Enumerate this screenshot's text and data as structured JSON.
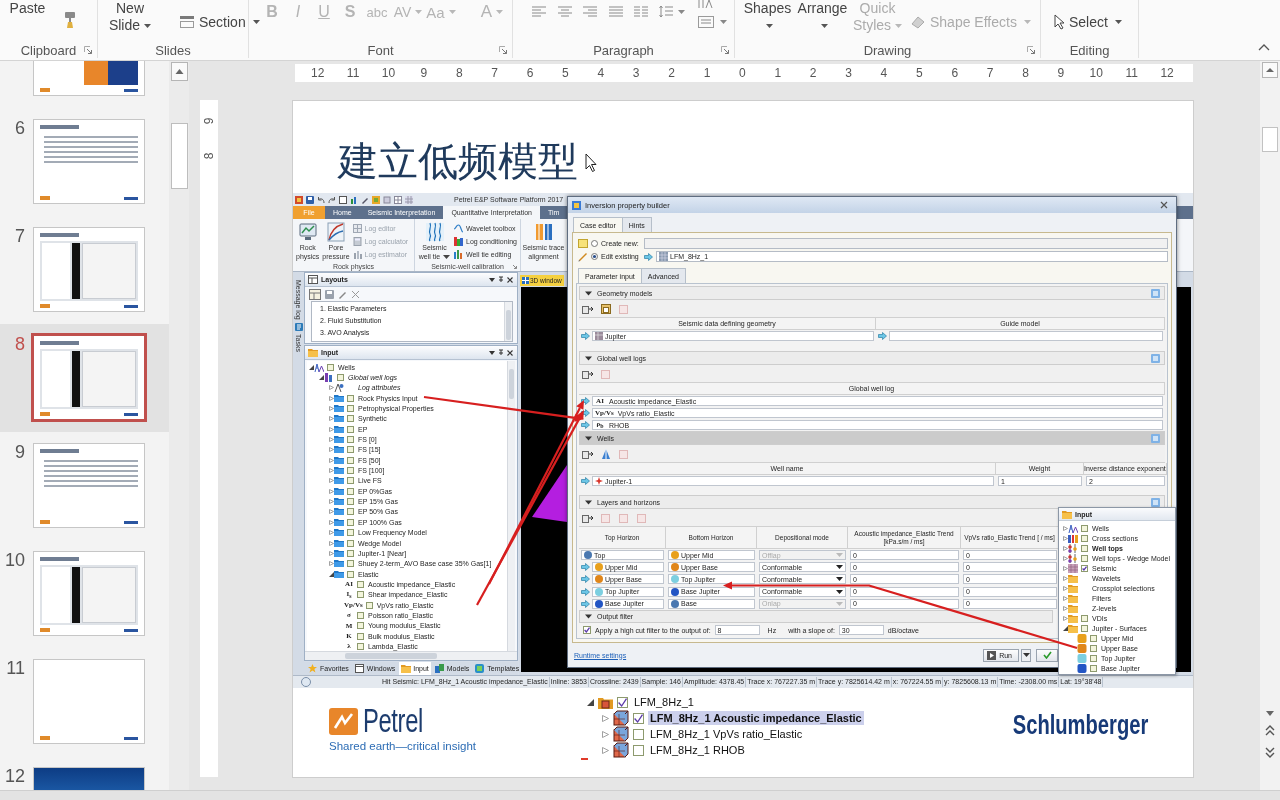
{
  "ribbon": {
    "groups": [
      {
        "label": "Clipboard",
        "launcher": true,
        "buttons": [
          {
            "kind": "large",
            "label": "Paste",
            "disabled": false
          }
        ]
      },
      {
        "label": "Slides",
        "buttons": [
          {
            "kind": "large",
            "label": "New Slide",
            "dropdown": true,
            "disabled": false
          },
          {
            "kind": "small",
            "label": "Section",
            "dropdown": true,
            "disabled": false
          }
        ]
      },
      {
        "label": "Font",
        "launcher": true,
        "buttons": [
          {
            "kind": "glyph",
            "label": "B",
            "disabled": true
          },
          {
            "kind": "glyph",
            "label": "I",
            "disabled": true
          },
          {
            "kind": "glyph",
            "label": "U",
            "disabled": true
          },
          {
            "kind": "glyph",
            "label": "S",
            "disabled": true
          },
          {
            "kind": "glyph",
            "label": "abc",
            "disabled": true
          },
          {
            "kind": "glyph",
            "label": "AV",
            "dropdown": true,
            "disabled": true
          },
          {
            "kind": "glyph",
            "label": "Aa",
            "dropdown": true,
            "disabled": true
          },
          {
            "kind": "glyph",
            "label": "A",
            "dropdown": true,
            "disabled": true
          }
        ]
      },
      {
        "label": "Paragraph",
        "launcher": true
      },
      {
        "label": "Drawing",
        "launcher": true,
        "buttons": [
          {
            "kind": "large",
            "label": "Shapes",
            "dropdown": true,
            "disabled": false
          },
          {
            "kind": "large",
            "label": "Arrange",
            "dropdown": true,
            "disabled": false
          },
          {
            "kind": "large",
            "label": "Quick Styles",
            "dropdown": true,
            "disabled": true
          },
          {
            "kind": "small",
            "label": "Shape Effects",
            "dropdown": true,
            "disabled": true
          }
        ]
      },
      {
        "label": "Editing",
        "buttons": [
          {
            "kind": "small",
            "label": "Select",
            "dropdown": true,
            "disabled": false
          }
        ]
      }
    ]
  },
  "slides_panel": {
    "slides": [
      {
        "kind": "picture",
        "selected": false
      },
      {
        "number": "6",
        "kind": "text",
        "selected": false
      },
      {
        "number": "7",
        "kind": "screenshot",
        "selected": false
      },
      {
        "number": "8",
        "kind": "screenshot",
        "selected": true
      },
      {
        "number": "9",
        "kind": "text",
        "selected": false
      },
      {
        "number": "10",
        "kind": "screenshot",
        "selected": false
      },
      {
        "number": "11",
        "kind": "blank",
        "selected": false
      },
      {
        "number": "12",
        "kind": "cover",
        "selected": false
      }
    ]
  },
  "rulers": {
    "horizontal": [
      "12",
      "11",
      "10",
      "9",
      "8",
      "7",
      "6",
      "5",
      "4",
      "3",
      "2",
      "1",
      "0",
      "1",
      "2",
      "3",
      "4",
      "5",
      "6",
      "7",
      "8",
      "9",
      "10",
      "11",
      "12"
    ],
    "vertical": [
      "9",
      "8"
    ]
  },
  "slide": {
    "title": "建立低频模型",
    "screenshot": {
      "title": "Petrel E&P Software Platform 2017",
      "tabs": [
        {
          "kind": "file",
          "label": "File",
          "selected": false
        },
        {
          "kind": "tab",
          "label": "Home",
          "selected": false
        },
        {
          "kind": "tab",
          "label": "Seismic Interpretation",
          "selected": false
        },
        {
          "kind": "tab",
          "label": "Quantitative Interpretation",
          "selected": true
        },
        {
          "kind": "tab",
          "label": "Tim",
          "selected": false
        }
      ],
      "ribbon": [
        {
          "label": "Rock physics",
          "buttons": [
            {
              "kind": "large",
              "label": "Rock physics",
              "disabled": false
            },
            {
              "kind": "large",
              "label": "Pore pressure",
              "disabled": false
            },
            {
              "kind": "small",
              "label": "Log editor",
              "disabled": true
            },
            {
              "kind": "small",
              "label": "Log calculator",
              "disabled": true
            },
            {
              "kind": "small",
              "label": "Log estimator",
              "disabled": true
            }
          ]
        },
        {
          "label": "Seismic-well calibration",
          "launcher": true,
          "buttons": [
            {
              "kind": "large",
              "label": "Seismic well tie",
              "dropdown": true,
              "disabled": false
            },
            {
              "kind": "small",
              "label": "Wavelet toolbox",
              "disabled": false
            },
            {
              "kind": "small",
              "label": "Log conditioning",
              "disabled": false
            },
            {
              "kind": "small",
              "label": "Well tie editing",
              "disabled": false
            }
          ]
        },
        {
          "buttons": [
            {
              "kind": "large",
              "label": "Seismic trace alignment",
              "disabled": false
            }
          ]
        }
      ],
      "side_tabs": [
        "Message log",
        "Tasks"
      ],
      "layouts": {
        "title": "Layouts",
        "items": [
          "1. Elastic Parameters",
          "2. Fluid Substitution",
          "3. AVO Analysis"
        ]
      },
      "input": {
        "title": "Input",
        "tree": [
          {
            "kind": "wells",
            "label": "Wells",
            "checked": false,
            "expanded": true,
            "children": [
              {
                "kind": "collection",
                "label": "Global well logs",
                "checked": false,
                "expanded": true,
                "children": [
                  {
                    "kind": "attributes",
                    "label": "Log attributes",
                    "expanded": false
                  },
                  {
                    "kind": "folder",
                    "label": "Rock Physics Input",
                    "checked": false,
                    "expanded": false
                  },
                  {
                    "kind": "folder",
                    "label": "Petrophysical Properties",
                    "checked": false,
                    "expanded": false
                  },
                  {
                    "kind": "folder",
                    "label": "Synthetic",
                    "checked": false,
                    "expanded": false
                  },
                  {
                    "kind": "folder",
                    "label": "EP",
                    "checked": false,
                    "expanded": false
                  },
                  {
                    "kind": "folder",
                    "label": "FS [0]",
                    "checked": false,
                    "expanded": false
                  },
                  {
                    "kind": "folder",
                    "label": "FS [15]",
                    "checked": false,
                    "expanded": false
                  },
                  {
                    "kind": "folder",
                    "label": "FS [50]",
                    "checked": false,
                    "expanded": false
                  },
                  {
                    "kind": "folder",
                    "label": "FS [100]",
                    "checked": false,
                    "expanded": false
                  },
                  {
                    "kind": "folder",
                    "label": "Live FS",
                    "checked": false,
                    "expanded": false
                  },
                  {
                    "kind": "folder",
                    "label": "EP 0%Gas",
                    "checked": false,
                    "expanded": false
                  },
                  {
                    "kind": "folder",
                    "label": "EP 15% Gas",
                    "checked": false,
                    "expanded": false
                  },
                  {
                    "kind": "folder",
                    "label": "EP 50% Gas",
                    "checked": false,
                    "expanded": false
                  },
                  {
                    "kind": "folder",
                    "label": "EP 100% Gas",
                    "checked": false,
                    "expanded": false
                  },
                  {
                    "kind": "folder",
                    "label": "Low Frequency Model",
                    "checked": false,
                    "expanded": false
                  },
                  {
                    "kind": "folder",
                    "label": "Wedge Model",
                    "checked": false,
                    "expanded": false
                  },
                  {
                    "kind": "folder",
                    "label": "Jupiter-1 [Near]",
                    "checked": false,
                    "expanded": false
                  },
                  {
                    "kind": "folder",
                    "label": "Shuey 2-term_AVO Base case 35% Gas[1]",
                    "checked": false,
                    "expanded": false
                  },
                  {
                    "kind": "folder",
                    "label": "Elastic",
                    "checked": false,
                    "expanded": true,
                    "children": [
                      {
                        "kind": "log",
                        "glyph": "AI",
                        "label": "Acoustic impedance_Elastic",
                        "checked": false
                      },
                      {
                        "kind": "log",
                        "glyph": "I$_{s}$",
                        "label": "Shear impedance_Elastic",
                        "checked": false
                      },
                      {
                        "kind": "log",
                        "glyph": "Vp/Vs",
                        "label": "VpVs ratio_Elastic",
                        "checked": false
                      },
                      {
                        "kind": "log",
                        "glyph": "σ",
                        "label": "Poisson ratio_Elastic",
                        "checked": false
                      },
                      {
                        "kind": "log",
                        "glyph": "M",
                        "label": "Young modulus_Elastic",
                        "checked": false
                      },
                      {
                        "kind": "log",
                        "glyph": "K",
                        "label": "Bulk modulus_Elastic",
                        "checked": false
                      },
                      {
                        "kind": "log",
                        "glyph": "λ",
                        "label": "Lambda_Elastic",
                        "checked": false
                      }
                    ]
                  }
                ]
              }
            ]
          }
        ]
      },
      "bottom_tabs": [
        {
          "label": "Favorites",
          "selected": false
        },
        {
          "label": "Windows",
          "selected": false
        },
        {
          "label": "Input",
          "selected": true
        },
        {
          "label": "Models",
          "selected": false
        },
        {
          "label": "Templates",
          "selected": false
        }
      ],
      "viewer_tab": "3D window",
      "status": [
        "Hit Seismic: LFM_8Hz_1 Acoustic impedance_Elastic",
        "Inline: 3853",
        "Crossline: 2439",
        "Sample: 146",
        "Amplitude: 4378.45",
        "Trace x: 767227.35 m",
        "Trace y: 7825614.42 m",
        "x: 767224.55 m",
        "y: 7825608.13 m",
        "Time: -2308.00 ms",
        "Lat: 19°38'48"
      ],
      "dialog": {
        "title": "Inversion property builder",
        "tabs": [
          {
            "label": "Case editor",
            "selected": true
          },
          {
            "label": "Hints",
            "selected": false
          }
        ],
        "modes": [
          {
            "label": "Create new:",
            "selected": false
          },
          {
            "label": "Edit existing",
            "selected": true,
            "value": "LFM_8Hz_1"
          }
        ],
        "subtabs": [
          {
            "label": "Parameter input",
            "selected": true
          },
          {
            "label": "Advanced",
            "selected": false
          }
        ],
        "sections": [
          {
            "kind": "geometry",
            "title": "Geometry models",
            "expanded": true,
            "selected": false,
            "columns": [
              "Seismic data defining geometry",
              "Guide model"
            ],
            "rows": [
              {
                "cells": [
                  "Jupiter"
                ]
              }
            ]
          },
          {
            "kind": "logs",
            "title": "Global well logs",
            "expanded": true,
            "selected": false,
            "columns": [
              "Global well log"
            ],
            "rows": [
              {
                "glyph": "AI",
                "cells": [
                  "Acoustic impedance_Elastic"
                ]
              },
              {
                "glyph": "Vp/Vs",
                "cells": [
                  "VpVs ratio_Elastic"
                ]
              },
              {
                "glyph": "ρ$_{b}$",
                "cells": [
                  "RHOB"
                ]
              }
            ]
          },
          {
            "kind": "wells",
            "title": "Wells",
            "expanded": true,
            "selected": true,
            "columns": [
              "Well name",
              "Weight",
              "Inverse distance exponent"
            ],
            "rows": [
              {
                "cells": [
                  "Jupiter-1",
                  "1",
                  "2"
                ]
              }
            ]
          },
          {
            "kind": "layers",
            "title": "Layers and horizons",
            "expanded": true,
            "selected": false,
            "columns": [
              "Top Horizon",
              "Bottom Horizon",
              "Depositional mode",
              "Acoustic impedance_Elastic Trend [kPa.s/m / ms]",
              "VpVs ratio_Elastic Trend [ / ms]"
            ],
            "rows": [
              {
                "arrow": false,
                "top": {
                  "name": "Top",
                  "color": "#4a78b0"
                },
                "bottom": {
                  "name": "Upper Mid",
                  "color": "#e8a01c"
                },
                "mode": "Offlap",
                "disabled": true,
                "cells": [
                  "0",
                  "0"
                ]
              },
              {
                "arrow": true,
                "top": {
                  "name": "Upper Mid",
                  "color": "#e8a01c"
                },
                "bottom": {
                  "name": "Upper Base",
                  "color": "#e0861a"
                },
                "mode": "Conformable",
                "disabled": false,
                "cells": [
                  "0",
                  "0"
                ]
              },
              {
                "arrow": true,
                "top": {
                  "name": "Upper Base",
                  "color": "#e0861a"
                },
                "bottom": {
                  "name": "Top Jupiter",
                  "color": "#7ccfe0"
                },
                "mode": "Conformable",
                "disabled": false,
                "cells": [
                  "0",
                  "0"
                ]
              },
              {
                "arrow": true,
                "top": {
                  "name": "Top Jupiter",
                  "color": "#7ccfe0"
                },
                "bottom": {
                  "name": "Base Jupiter",
                  "color": "#2255c4"
                },
                "mode": "Conformable",
                "disabled": false,
                "cells": [
                  "0",
                  "0"
                ]
              },
              {
                "arrow": true,
                "top": {
                  "name": "Base Jupiter",
                  "color": "#2255c4"
                },
                "bottom": {
                  "name": "Base",
                  "color": "#4a78b0"
                },
                "mode": "Onlap",
                "disabled": true,
                "cells": [
                  "0",
                  "0"
                ]
              }
            ]
          },
          {
            "kind": "filter",
            "title": "Output filter",
            "expanded": true,
            "selected": false,
            "checked": true,
            "label": "Apply a high cut filter to the output of:",
            "value": "8",
            "unit": "Hz",
            "slope_label": "with a slope of:",
            "slope": "30",
            "slope_unit": "dB/octave"
          }
        ],
        "link": "Runtime settings",
        "run": "Run"
      },
      "input_popup": {
        "title": "Input",
        "items": [
          {
            "kind": "wells",
            "label": "Wells",
            "checked": false,
            "expanded": false,
            "active": false
          },
          {
            "kind": "sections",
            "label": "Cross sections",
            "checked": false,
            "expanded": false,
            "active": false
          },
          {
            "kind": "tops",
            "label": "Well tops",
            "checked": false,
            "expanded": false,
            "active": true
          },
          {
            "kind": "tops",
            "label": "Well tops - Wedge Model",
            "checked": false,
            "expanded": false,
            "active": false
          },
          {
            "kind": "seismic",
            "label": "Seismic",
            "checked": true,
            "expanded": false,
            "active": false
          },
          {
            "kind": "folder",
            "label": "Wavelets",
            "expanded": false,
            "active": false
          },
          {
            "kind": "folder",
            "label": "Crossplot selections",
            "expanded": false,
            "active": false
          },
          {
            "kind": "folder",
            "label": "Filters",
            "expanded": false,
            "active": false
          },
          {
            "kind": "folder",
            "label": "Z-levels",
            "expanded": false,
            "active": false
          },
          {
            "kind": "folder",
            "label": "VDIs",
            "checked": false,
            "expanded": false,
            "active": false
          },
          {
            "kind": "folder",
            "label": "Jupiter - Surfaces",
            "checked": false,
            "expanded": true,
            "active": false,
            "children": [
              {
                "kind": "surface",
                "label": "Upper Mid",
                "color": "#e8a01c",
                "checked": false
              },
              {
                "kind": "surface",
                "label": "Upper Base",
                "color": "#e0861a",
                "checked": false
              },
              {
                "kind": "surface",
                "label": "Top Jupiter",
                "color": "#7ccfe0",
                "checked": false
              },
              {
                "kind": "surface",
                "label": "Base Jupiter",
                "color": "#2255c4",
                "checked": false
              }
            ]
          }
        ]
      }
    },
    "footer": {
      "brand": "Petrel",
      "tagline": "Shared earth—critical insight",
      "tree": {
        "label": "LFM_8Hz_1",
        "expanded": true,
        "checked": true,
        "children": [
          {
            "label": "LFM_8Hz_1 Acoustic impedance_Elastic",
            "expanded": false,
            "checked": true,
            "selected": true
          },
          {
            "label": "LFM_8Hz_1 VpVs ratio_Elastic",
            "expanded": false,
            "checked": false,
            "selected": false
          },
          {
            "label": "LFM_8Hz_1 RHOB",
            "expanded": false,
            "checked": false,
            "selected": false
          }
        ]
      },
      "company": "Schlumberger"
    }
  }
}
